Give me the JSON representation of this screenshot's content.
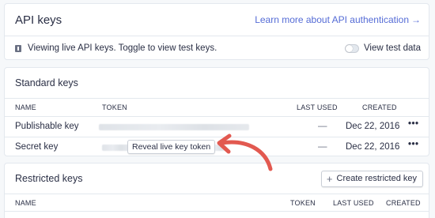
{
  "api_keys": {
    "title": "API keys",
    "learn_link": "Learn more about API authentication",
    "learn_arrow": "→",
    "info_text": "Viewing live API keys. Toggle to view test keys.",
    "toggle_label": "View test data"
  },
  "standard_keys": {
    "title": "Standard keys",
    "columns": {
      "name": "NAME",
      "token": "TOKEN",
      "last_used": "LAST USED",
      "created": "CREATED"
    },
    "rows": [
      {
        "name": "Publishable key",
        "last_used": "—",
        "created": "Dec 22, 2016",
        "menu": "•••"
      },
      {
        "name": "Secret key",
        "reveal_label": "Reveal live key token",
        "last_used": "—",
        "created": "Dec 22, 2016",
        "menu": "•••"
      }
    ]
  },
  "restricted_keys": {
    "title": "Restricted keys",
    "create_label": "Create restricted key",
    "create_icon": "+",
    "columns": {
      "name": "NAME",
      "token": "TOKEN",
      "last_used": "LAST USED",
      "created": "CREATED"
    }
  },
  "colors": {
    "accent": "#556cd6",
    "annotation_arrow": "#e25950",
    "border": "#e3e8ee",
    "background": "#f6f8fa"
  },
  "icons": {
    "info": "info-icon",
    "toggle": "toggle-switch",
    "plus": "plus-icon",
    "annotation": "curved-arrow-icon"
  }
}
